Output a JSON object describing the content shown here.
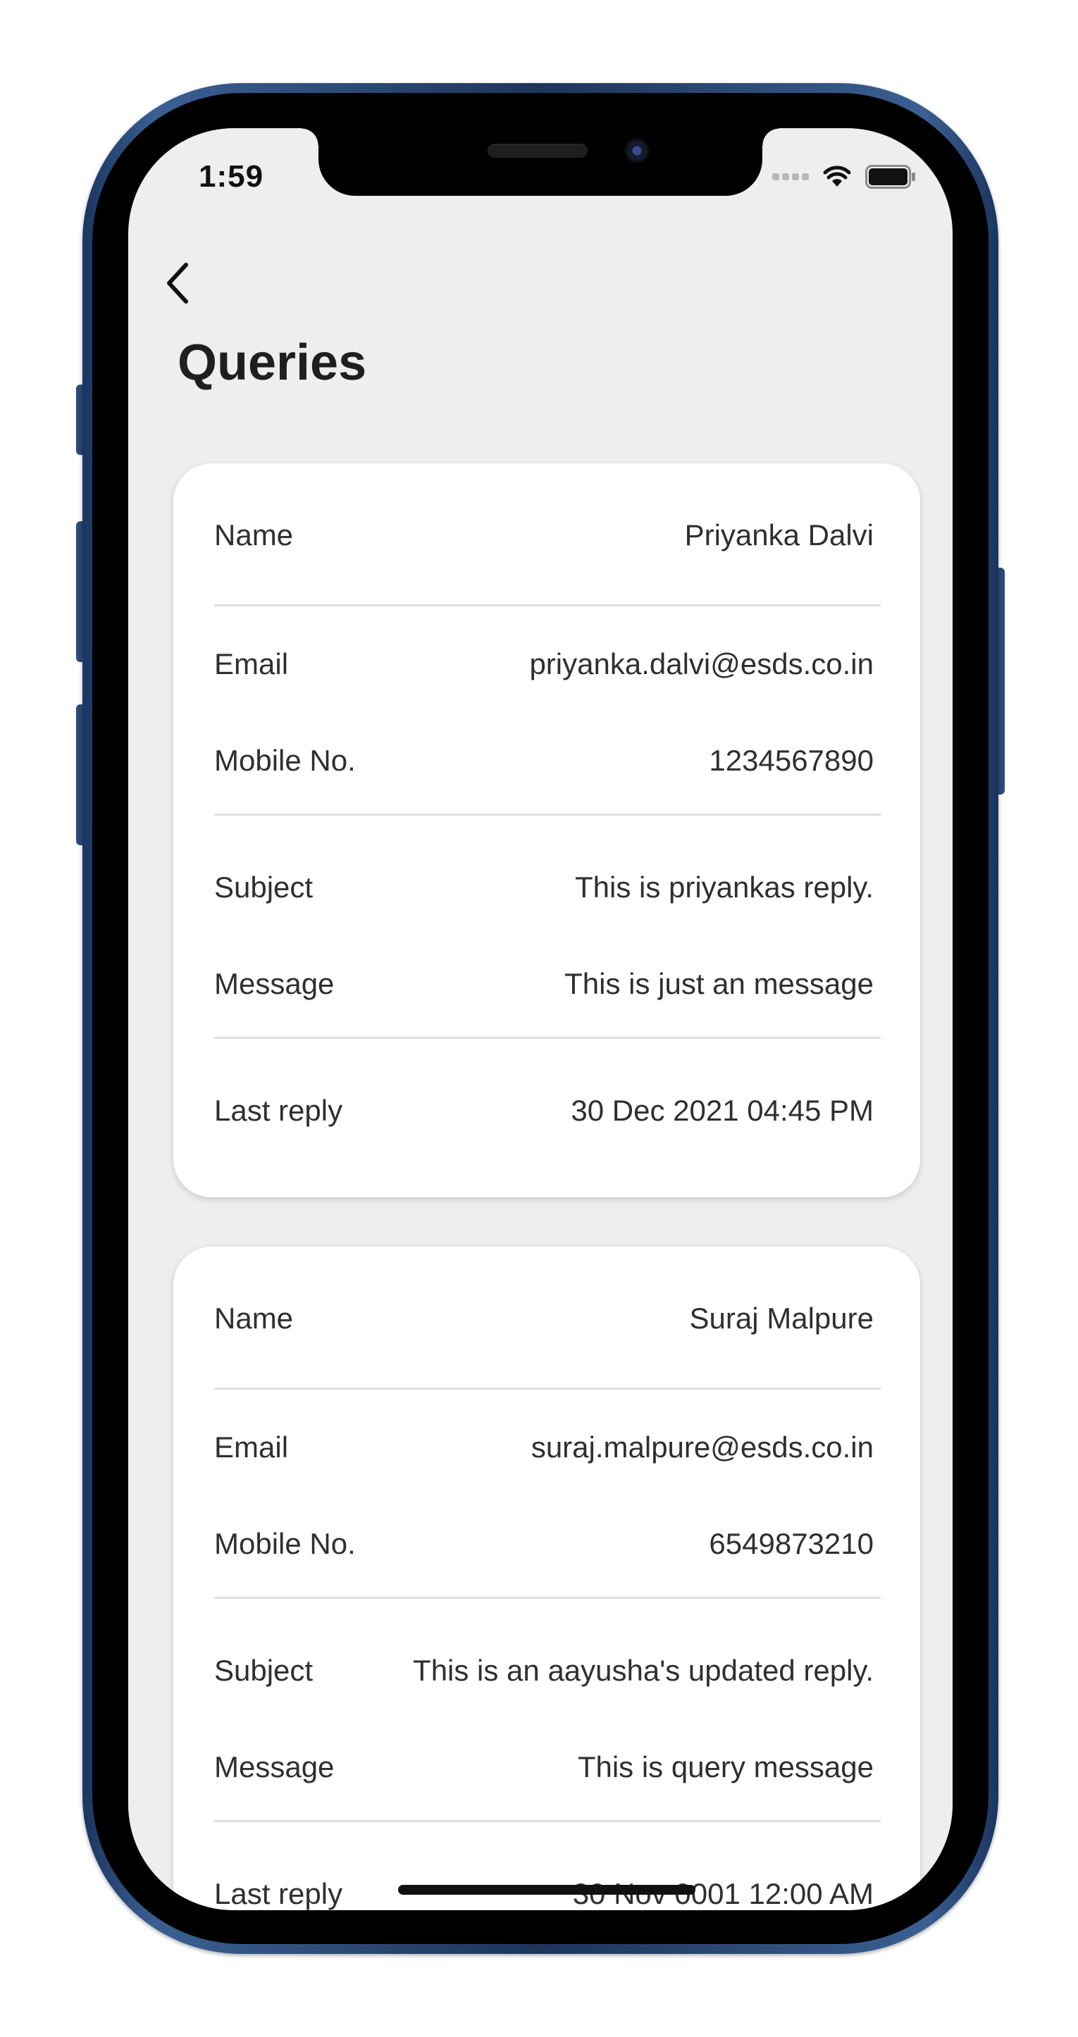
{
  "status_bar": {
    "time": "1:59"
  },
  "header": {
    "back_icon": "chevron-left-icon",
    "title": "Queries"
  },
  "queries": [
    {
      "name_label": "Name",
      "name": "Priyanka Dalvi",
      "email_label": "Email",
      "email": "priyanka.dalvi@esds.co.in",
      "mobile_label": "Mobile No.",
      "mobile": "1234567890",
      "subject_label": "Subject",
      "subject": "This is priyankas reply.",
      "message_label": "Message",
      "message": "This is just an message",
      "last_reply_label": "Last reply",
      "last_reply": "30 Dec 2021 04:45 PM"
    },
    {
      "name_label": "Name",
      "name": "Suraj Malpure",
      "email_label": "Email",
      "email": "suraj.malpure@esds.co.in",
      "mobile_label": "Mobile No.",
      "mobile": "6549873210",
      "subject_label": "Subject",
      "subject": "This is an aayusha's updated reply.",
      "message_label": "Message",
      "message": "This is query message",
      "last_reply_label": "Last reply",
      "last_reply": "30 Nov 0001 12:00 AM"
    }
  ],
  "colors": {
    "screen_background": "#eeeeee",
    "card_background": "#ffffff",
    "text": "#2f2f2f",
    "divider": "#dedede",
    "phone_frame": "#2c4a78"
  }
}
